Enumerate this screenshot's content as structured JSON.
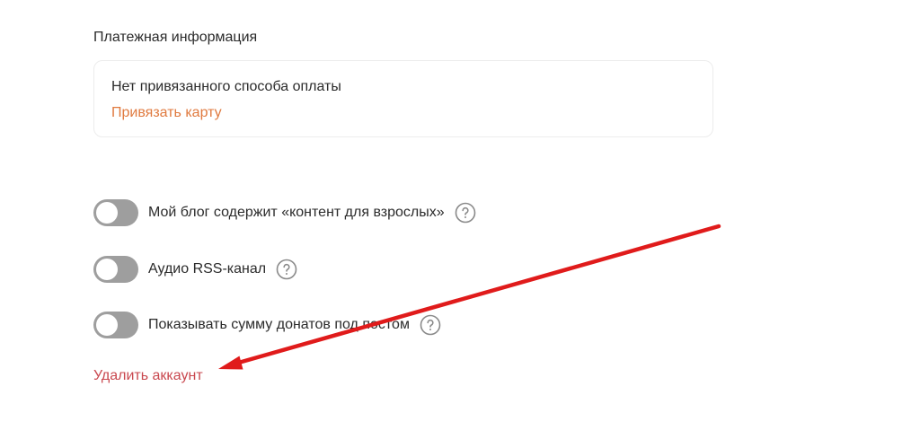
{
  "payment": {
    "title": "Платежная информация",
    "status": "Нет привязанного способа оплаты",
    "bind_card_label": "Привязать карту",
    "link_color": "#e07a3f"
  },
  "toggles": [
    {
      "label": "Мой блог содержит «контент для взрослых»",
      "enabled": false,
      "help_icon": "question-circle-icon"
    },
    {
      "label": "Аудио RSS-канал",
      "enabled": false,
      "help_icon": "question-circle-icon"
    },
    {
      "label": "Показывать сумму донатов под постом",
      "enabled": false,
      "help_icon": "question-circle-icon"
    }
  ],
  "account": {
    "delete_label": "Удалить аккаунт",
    "delete_color": "#c9484f"
  },
  "annotation": {
    "arrow_color": "#e01b1b",
    "points_to": "delete-account-link"
  }
}
